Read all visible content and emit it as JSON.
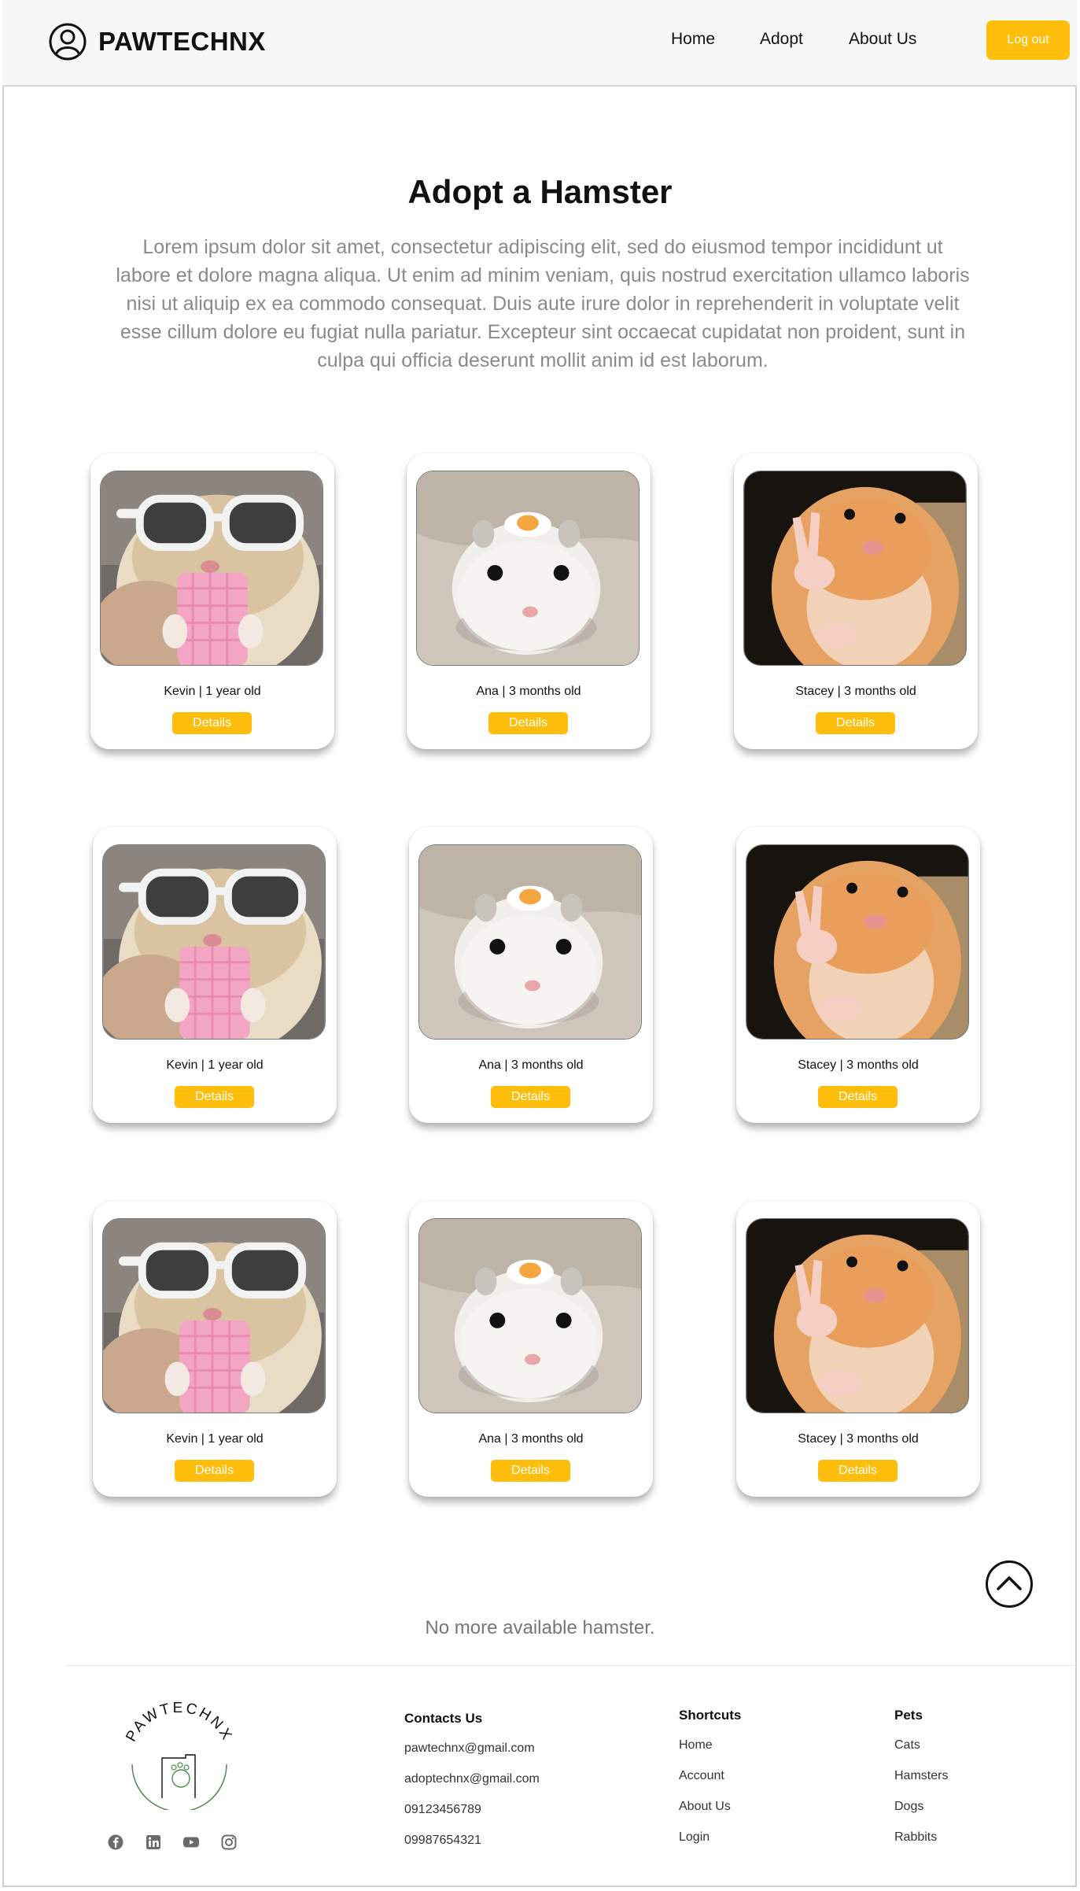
{
  "header": {
    "brand": "PAWTECHNX",
    "nav": [
      "Home",
      "Adopt",
      "About Us"
    ],
    "logout_label": "Log out"
  },
  "hero": {
    "title": "Adopt a Hamster",
    "description": "Lorem ipsum dolor sit amet, consectetur adipiscing elit, sed do eiusmod tempor incididunt ut labore et dolore magna aliqua. Ut enim ad minim veniam, quis nostrud exercitation ullamco laboris nisi ut aliquip ex ea commodo consequat. Duis aute irure dolor in reprehenderit in voluptate velit esse cillum dolore eu fugiat nulla pariatur. Excepteur sint occaecat cupidatat non proident, sunt in culpa qui officia deserunt mollit anim id est laborum."
  },
  "cards": [
    {
      "caption": "Kevin | 1 year old",
      "button": "Details",
      "photo": "hamster-sunglasses"
    },
    {
      "caption": "Ana | 3 months old",
      "button": "Details",
      "photo": "hamster-egg"
    },
    {
      "caption": "Stacey | 3 months old",
      "button": "Details",
      "photo": "hamster-peace"
    },
    {
      "caption": "Kevin | 1 year old",
      "button": "Details",
      "photo": "hamster-sunglasses"
    },
    {
      "caption": "Ana | 3 months old",
      "button": "Details",
      "photo": "hamster-egg"
    },
    {
      "caption": "Stacey | 3 months old",
      "button": "Details",
      "photo": "hamster-peace"
    },
    {
      "caption": "Kevin | 1 year old",
      "button": "Details",
      "photo": "hamster-sunglasses"
    },
    {
      "caption": "Ana | 3 months old",
      "button": "Details",
      "photo": "hamster-egg"
    },
    {
      "caption": "Stacey | 3 months old",
      "button": "Details",
      "photo": "hamster-peace"
    }
  ],
  "no_more": "No more available hamster.",
  "footer": {
    "logo_text": "PAWTECHNX",
    "contacts": {
      "title": "Contacts Us",
      "items": [
        "pawtechnx@gmail.com",
        "adoptechnx@gmail.com",
        "09123456789",
        "09987654321"
      ]
    },
    "shortcuts": {
      "title": "Shortcuts",
      "items": [
        "Home",
        "Account",
        "About Us",
        "Login"
      ]
    },
    "pets": {
      "title": "Pets",
      "items": [
        "Cats",
        "Hamsters",
        "Dogs",
        "Rabbits"
      ]
    },
    "socials": [
      "facebook-icon",
      "linkedin-icon",
      "youtube-icon",
      "instagram-icon"
    ]
  },
  "colors": {
    "accent": "#FFBE0B",
    "header_bg": "#f7f7f7",
    "muted_text": "#8a8a8a"
  }
}
